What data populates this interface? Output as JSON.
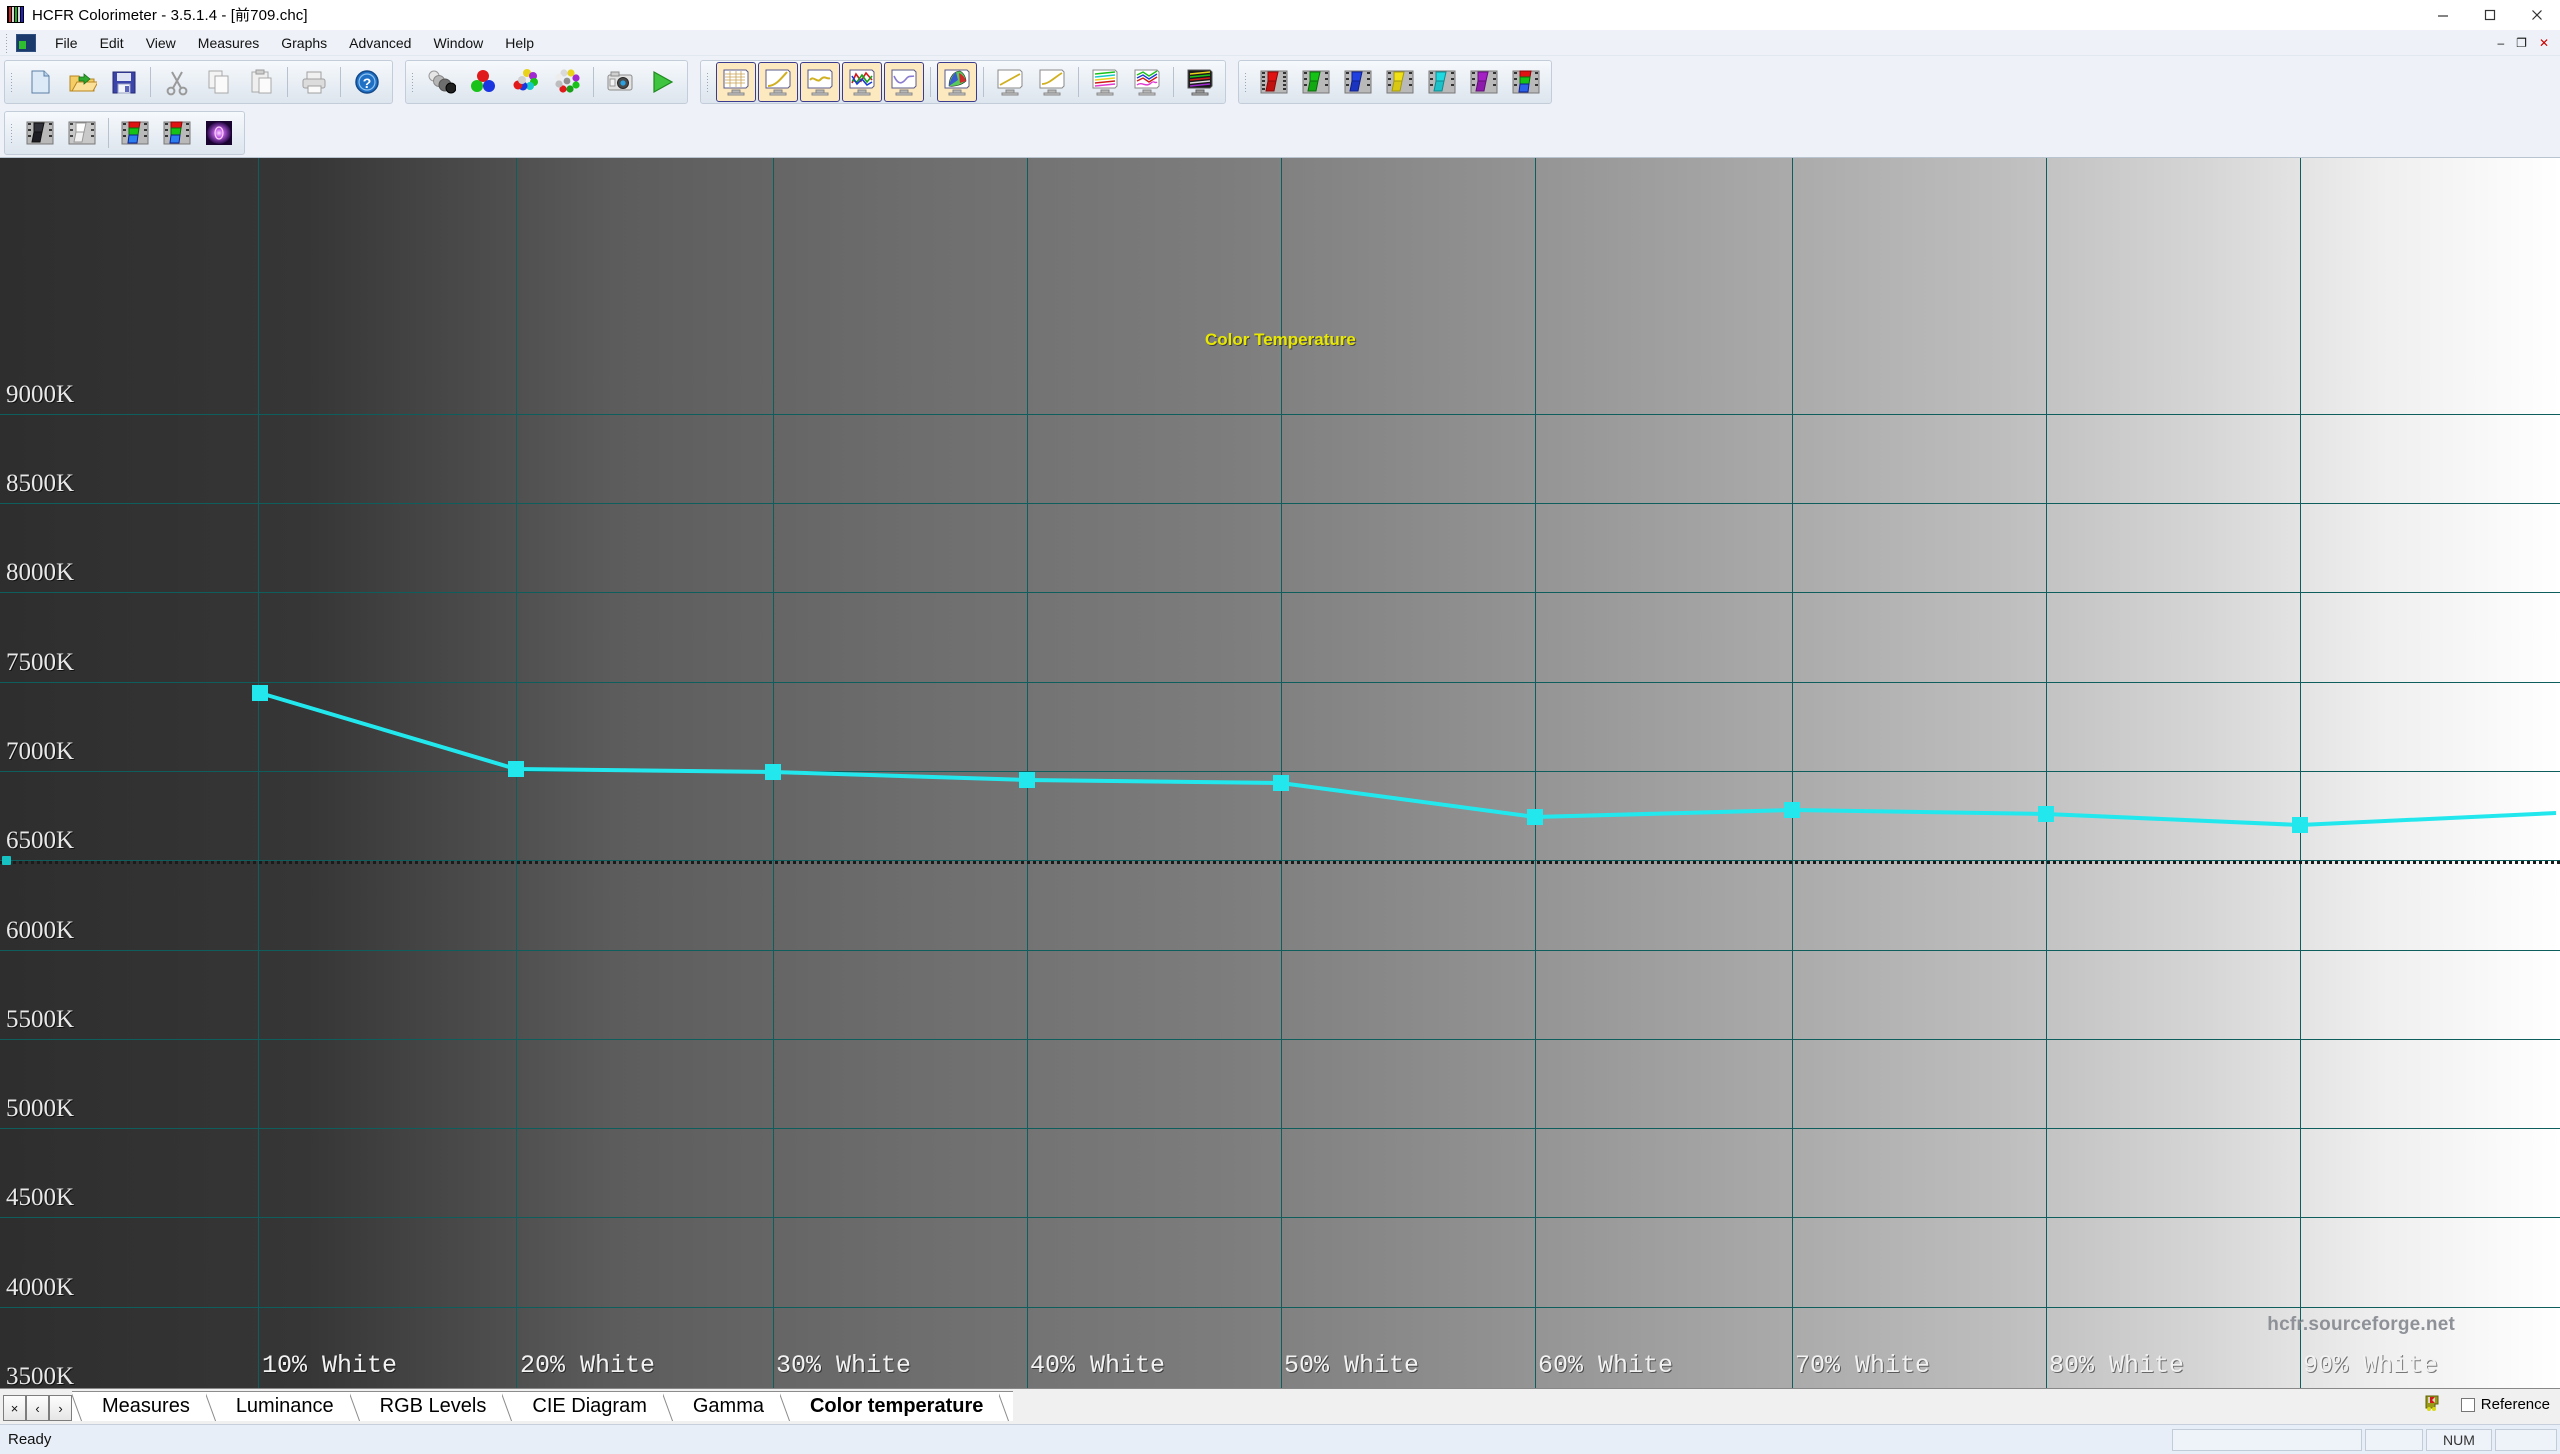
{
  "window": {
    "title": "HCFR Colorimeter - 3.5.1.4 - [前709.chc]",
    "logo_icon": "hcfr-bars-logo-icon",
    "minimize_label": "—",
    "maximize_label": "☐",
    "close_label": "✕",
    "inner_minimize_label": "–",
    "inner_restore_label": "❐",
    "inner_close_label": "✕"
  },
  "menubar": {
    "mdi_icon": "document-window-icon",
    "items": [
      {
        "label": "File"
      },
      {
        "label": "Edit"
      },
      {
        "label": "View"
      },
      {
        "label": "Measures"
      },
      {
        "label": "Graphs"
      },
      {
        "label": "Advanced"
      },
      {
        "label": "Window"
      },
      {
        "label": "Help"
      }
    ]
  },
  "toolbars": {
    "standard": [
      {
        "name": "new-file-button",
        "icon": "new-document-icon"
      },
      {
        "name": "open-file-button",
        "icon": "open-folder-icon"
      },
      {
        "name": "save-file-button",
        "icon": "floppy-save-icon"
      },
      {
        "name": "cut-button",
        "icon": "scissors-icon"
      },
      {
        "name": "copy-button",
        "icon": "copy-pages-icon"
      },
      {
        "name": "paste-button",
        "icon": "clipboard-icon"
      },
      {
        "name": "print-button",
        "icon": "printer-icon"
      },
      {
        "name": "help-button",
        "icon": "question-help-icon"
      }
    ],
    "measures": [
      {
        "name": "measure-grayscale-button",
        "icon": "grayscale-spheres-icon"
      },
      {
        "name": "measure-primaries-button",
        "icon": "rgb-spheres-icon"
      },
      {
        "name": "measure-saturations-button",
        "icon": "saturation-spheres-icon"
      },
      {
        "name": "measure-colorchecker-button",
        "icon": "colorchecker-ring-icon"
      },
      {
        "name": "capture-button",
        "icon": "camera-icon"
      },
      {
        "name": "run-measure-button",
        "icon": "play-triangle-icon"
      }
    ],
    "graphs": [
      {
        "name": "graph-measures-button",
        "icon": "monitor-table-icon",
        "selected": true
      },
      {
        "name": "graph-luminance-button",
        "icon": "monitor-curve-icon",
        "selected": true
      },
      {
        "name": "graph-gamma-button",
        "icon": "monitor-wave-icon",
        "selected": true
      },
      {
        "name": "graph-rgb-levels-button",
        "icon": "monitor-rgb-lines-icon",
        "selected": true
      },
      {
        "name": "graph-color-temperature-button",
        "icon": "monitor-violet-curve-icon",
        "selected": true
      },
      {
        "name": "graph-cie-diagram-button",
        "icon": "monitor-cie-icon",
        "selected": true
      },
      {
        "name": "graph-luminance-alt-button",
        "icon": "monitor-yellow-line-icon",
        "selected": false
      },
      {
        "name": "graph-gamma-alt-button",
        "icon": "monitor-yellow-ramp-icon",
        "selected": false
      },
      {
        "name": "graph-near-black-button",
        "icon": "monitor-multiline-icon",
        "selected": false
      },
      {
        "name": "graph-near-white-button",
        "icon": "monitor-multiwave-icon",
        "selected": false
      },
      {
        "name": "graph-dark-panel-button",
        "icon": "monitor-dark-multiline-icon",
        "selected": false
      }
    ],
    "colors": [
      {
        "name": "filter-red-button",
        "icon": "red-filmstrip-icon"
      },
      {
        "name": "filter-green-button",
        "icon": "green-filmstrip-icon"
      },
      {
        "name": "filter-blue-button",
        "icon": "blue-filmstrip-icon"
      },
      {
        "name": "filter-yellow-button",
        "icon": "yellow-filmstrip-icon"
      },
      {
        "name": "filter-cyan-button",
        "icon": "cyan-filmstrip-icon"
      },
      {
        "name": "filter-magenta-button",
        "icon": "magenta-filmstrip-icon"
      },
      {
        "name": "filter-rgb-button",
        "icon": "rgb-filmstrip-icon"
      }
    ],
    "row2": [
      {
        "name": "pattern-black-button",
        "icon": "black-filmstrip-icon"
      },
      {
        "name": "pattern-white-button",
        "icon": "white-filmstrip-icon"
      },
      {
        "name": "pattern-rgb-primaries-button",
        "icon": "rgb-stack-filmstrip-icon"
      },
      {
        "name": "pattern-rgb-secondaries-button",
        "icon": "rgb-stack2-filmstrip-icon"
      },
      {
        "name": "pattern-contrast-button",
        "icon": "purple-glow-icon"
      }
    ]
  },
  "chart_data": {
    "type": "line",
    "title": "Color Temperature",
    "xlabel": "",
    "ylabel": "",
    "watermark": "hcfr.sourceforge.net",
    "categories": [
      "10% White",
      "20% White",
      "30% White",
      "40% White",
      "50% White",
      "60% White",
      "70% White",
      "80% White",
      "90% White"
    ],
    "ylim": [
      3250,
      9250
    ],
    "yticks": [
      "9000K",
      "8500K",
      "8000K",
      "7500K",
      "7000K",
      "6500K",
      "6000K",
      "5500K",
      "5000K",
      "4500K",
      "4000K",
      "3500K"
    ],
    "ytick_values": [
      9000,
      8500,
      8000,
      7500,
      7000,
      6500,
      6000,
      5500,
      5000,
      4500,
      4000,
      3500
    ],
    "grid": true,
    "legend": "none",
    "reference_line": {
      "label": "6500K",
      "value": 6500,
      "style": "dotted",
      "color": "#1b1b1b"
    },
    "series": [
      {
        "name": "Color temperature",
        "color": "#22e8ee",
        "marker": "square",
        "values": [
          7440,
          7015,
          7000,
          6955,
          6940,
          6750,
          6790,
          6765,
          6700
        ]
      }
    ],
    "series_end_value": 6740,
    "background": "grayscale-ramp-dark-to-light"
  },
  "tabs": {
    "nav": [
      {
        "name": "tab-close-button",
        "label": "×"
      },
      {
        "name": "tab-prev-button",
        "label": "‹"
      },
      {
        "name": "tab-next-button",
        "label": "›"
      }
    ],
    "items": [
      {
        "label": "Measures",
        "active": false
      },
      {
        "label": "Luminance",
        "active": false
      },
      {
        "label": "RGB Levels",
        "active": false
      },
      {
        "label": "CIE Diagram",
        "active": false
      },
      {
        "label": "Gamma",
        "active": false
      },
      {
        "label": "Color temperature",
        "active": true
      }
    ],
    "reference_checkbox_label": "Reference",
    "reference_checked": false,
    "sensor_icon": "sensor-device-icon"
  },
  "statusbar": {
    "text": "Ready",
    "panels": [
      "",
      "",
      "NUM",
      ""
    ]
  }
}
